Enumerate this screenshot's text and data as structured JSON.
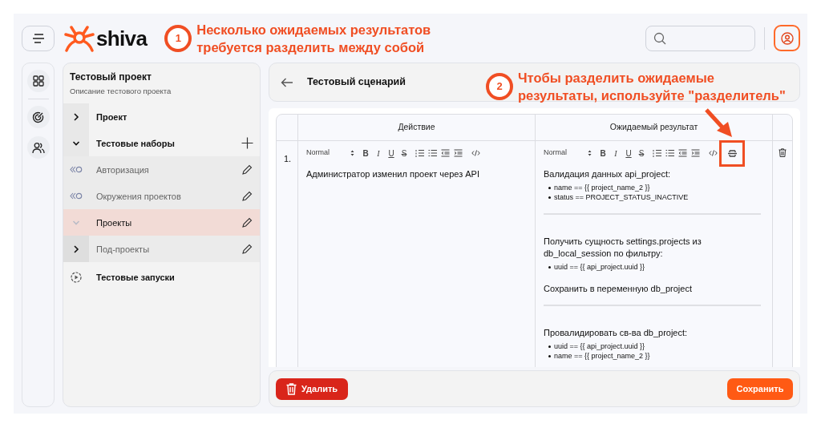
{
  "header": {
    "logo_text": "shiva"
  },
  "annotations": [
    {
      "number": "1",
      "lines": [
        "Несколько ожидаемых результатов",
        "требуется разделить между собой"
      ]
    },
    {
      "number": "2",
      "lines": [
        "Чтобы разделить ожидаемые",
        "результаты, используйте \"разделитель\""
      ]
    }
  ],
  "project": {
    "title": "Тестовый проект",
    "description": "Описание тестового проекта"
  },
  "tree": [
    {
      "label": "Проект",
      "kind": "section",
      "expanded": false
    },
    {
      "label": "Тестовые наборы",
      "kind": "section",
      "expanded": true,
      "children": [
        {
          "label": "Авторизация",
          "kind": "suite",
          "selected": false
        },
        {
          "label": "Окружения проектов",
          "kind": "suite",
          "selected": false
        },
        {
          "label": "Проекты",
          "kind": "folder",
          "expanded": true,
          "selected": true,
          "children": [
            {
              "label": "Под-проекты",
              "kind": "folder",
              "expanded": false,
              "selected": false
            }
          ]
        }
      ]
    },
    {
      "label": "Тестовые запуски",
      "kind": "runs"
    }
  ],
  "scenario": {
    "title": "Тестовый сценарий"
  },
  "table": {
    "columns": [
      "Действие",
      "Ожидаемый результат"
    ],
    "rows": [
      {
        "number": "1.",
        "action": {
          "format": "Normal",
          "text_tools": [
            {
              "kind": "bold",
              "glyph": "B"
            },
            {
              "kind": "italic",
              "glyph": "I"
            },
            {
              "kind": "underline",
              "glyph": "U"
            },
            {
              "kind": "strike",
              "glyph": "S"
            }
          ],
          "separator_tool": false,
          "blocks": [
            {
              "kind": "paragraph",
              "text": "Администратор изменил проект через API"
            }
          ]
        },
        "expected": {
          "format": "Normal",
          "text_tools": [
            {
              "kind": "bold",
              "glyph": "B"
            },
            {
              "kind": "italic",
              "glyph": "I"
            },
            {
              "kind": "underline",
              "glyph": "U"
            },
            {
              "kind": "strike",
              "glyph": "S"
            }
          ],
          "separator_tool": true,
          "separator_highlighted": true,
          "blocks": [
            {
              "kind": "paragraph",
              "text": "Валидация данных api_project:"
            },
            {
              "kind": "bullets",
              "items": [
                "name == {{ project_name_2 }}",
                "status == PROJECT_STATUS_INACTIVE"
              ]
            },
            {
              "kind": "separator"
            },
            {
              "kind": "paragraph",
              "text": "Получить сущность settings.projects из db_local_session по фильтру:"
            },
            {
              "kind": "bullets",
              "items": [
                "uuid == {{ api_project.uuid }}"
              ]
            },
            {
              "kind": "paragraph",
              "text": "Сохранить в переменную db_project"
            },
            {
              "kind": "separator"
            },
            {
              "kind": "paragraph",
              "text": "Провалидировать св-ва db_project:"
            },
            {
              "kind": "bullets",
              "items": [
                "uuid == {{ api_project.uuid }}",
                "name == {{ project_name_2 }}"
              ]
            }
          ]
        }
      }
    ]
  },
  "buttons": {
    "delete": "Удалить",
    "save": "Сохранить"
  }
}
